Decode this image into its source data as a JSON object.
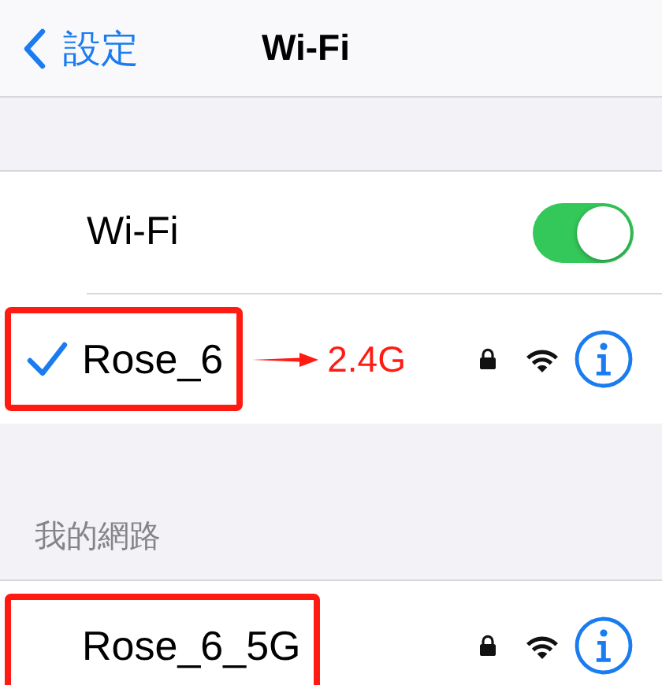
{
  "nav": {
    "back_label": "設定",
    "title": "Wi-Fi"
  },
  "wifi_toggle": {
    "label": "Wi-Fi",
    "on": true
  },
  "current_network": {
    "name": "Rose_6",
    "connected": true,
    "locked": true,
    "highlighted": true,
    "annotation": "2.4G"
  },
  "sections": [
    {
      "header": "我的網路",
      "networks": [
        {
          "name": "Rose_6_5G",
          "locked": true,
          "highlighted": true
        }
      ]
    }
  ]
}
